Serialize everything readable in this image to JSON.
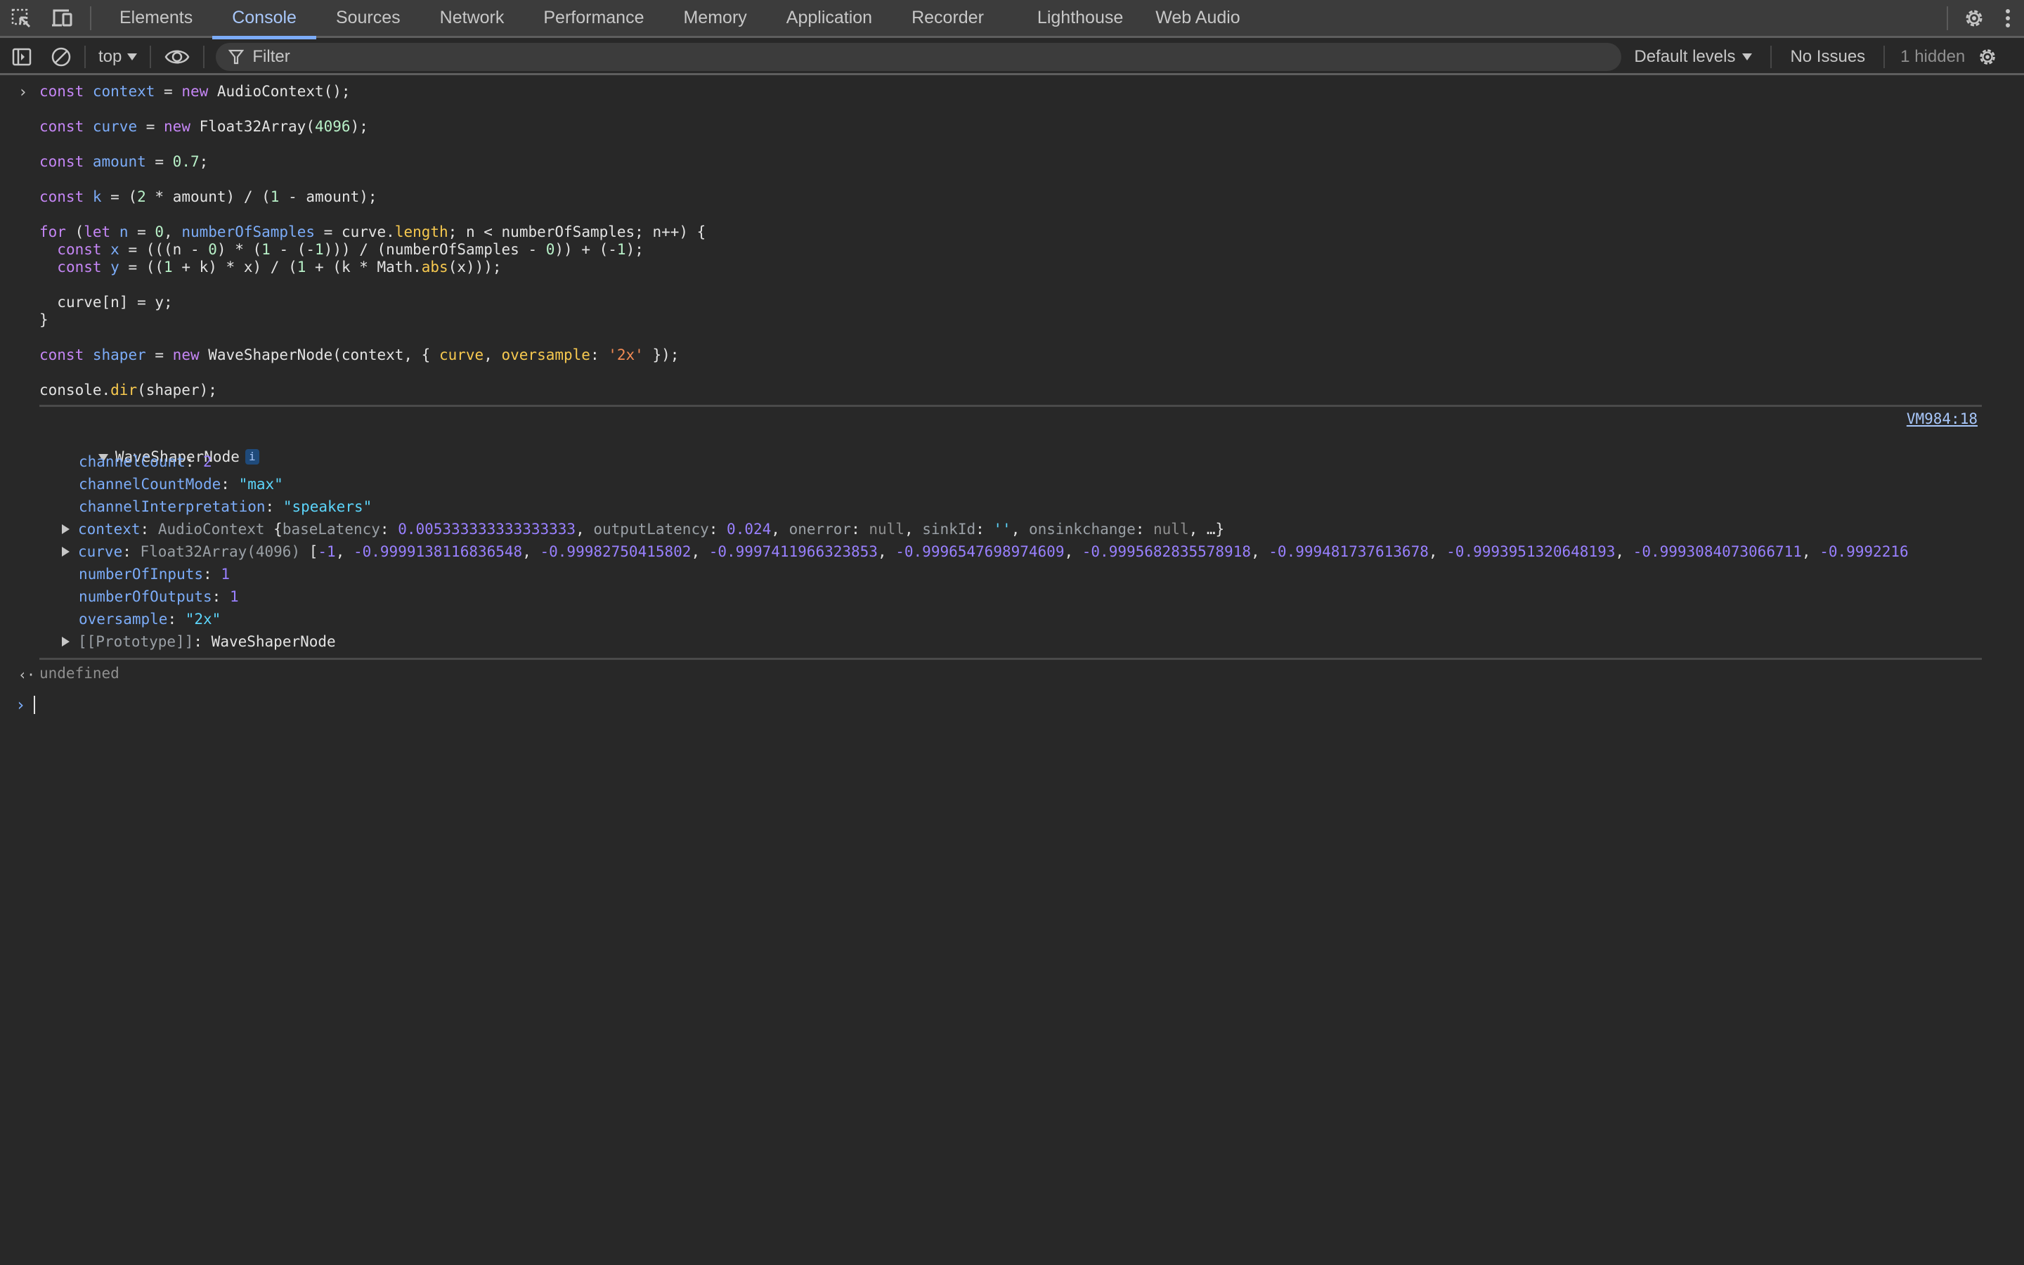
{
  "tabbar": {
    "tabs": [
      {
        "label": "Elements",
        "active": false
      },
      {
        "label": "Console",
        "active": true
      },
      {
        "label": "Sources",
        "active": false
      },
      {
        "label": "Network",
        "active": false
      },
      {
        "label": "Performance",
        "active": false
      },
      {
        "label": "Memory",
        "active": false
      },
      {
        "label": "Application",
        "active": false
      },
      {
        "label": "Recorder",
        "active": false
      },
      {
        "label": "Lighthouse",
        "active": false
      },
      {
        "label": "Web Audio",
        "active": false
      }
    ],
    "icons": [
      "inspect-element-icon",
      "device-toolbar-icon",
      "settings-icon",
      "more-options-icon"
    ]
  },
  "toolbar": {
    "context": "top",
    "filter_placeholder": "Filter",
    "levels": "Default levels",
    "issues": "No Issues",
    "hidden": "1 hidden"
  },
  "console": {
    "input_code": {
      "l1": {
        "kw1": "const",
        "v": "context",
        "eq": " = ",
        "kw2": "new",
        "rest": " AudioContext();"
      },
      "l2": {
        "kw1": "const",
        "v": "curve",
        "eq": " = ",
        "kw2": "new",
        "rest1": " Float32Array(",
        "num": "4096",
        "rest2": ");"
      },
      "l3": {
        "kw1": "const",
        "v": "amount",
        "eq": " = ",
        "num": "0.7",
        "rest": ";"
      },
      "l4": {
        "kw1": "const",
        "v": "k",
        "eq": " = (",
        "n1": "2",
        "m1": " * amount) / (",
        "n2": "1",
        "m2": " - amount);"
      },
      "l5": {
        "kw1": "for",
        "p1": " (",
        "kw2": "let",
        "v1": " n",
        "p2": " = ",
        "n1": "0",
        "p3": ", ",
        "v2": "numberOfSamples",
        "p4": " = curve.",
        "fn": "length",
        "p5": "; n < numberOfSamples; n++) {"
      },
      "l6": {
        "kw": "const",
        "v": "x",
        "a": " = (((n - ",
        "n0": "0",
        "b": ") * (",
        "n1": "1",
        "c": " - (-",
        "n2": "1",
        "d": "))) / (numberOfSamples - ",
        "n3": "0",
        "e": ")) + (-",
        "n4": "1",
        "f": ");"
      },
      "l7": {
        "kw": "const",
        "v": "y",
        "a": " = ((",
        "n1": "1",
        "b": " + k) * x) / (",
        "n2": "1",
        "c": " + (k * Math.",
        "fn": "abs",
        "d": "(x)));"
      },
      "l8": "curve[n] = y;",
      "l9": "}",
      "l10": {
        "kw1": "const",
        "v": "shaper",
        "eq": " = ",
        "kw2": "new",
        "a": " WaveShaperNode(context, { ",
        "p1": "curve",
        "b": ", ",
        "p2": "oversample",
        "c": ": ",
        "s": "'2x'",
        "d": " });"
      },
      "l11": {
        "a": "console.",
        "fn": "dir",
        "b": "(shaper);"
      }
    },
    "source_link": "VM984:18",
    "object": {
      "name": "WaveShaperNode",
      "info_badge": "i",
      "properties": {
        "channelCount": {
          "key": "channelCount",
          "value": "2"
        },
        "channelCountMode": {
          "key": "channelCountMode",
          "value": "\"max\""
        },
        "channelInterpretation": {
          "key": "channelInterpretation",
          "value": "\"speakers\""
        },
        "context": {
          "key": "context",
          "type": "AudioContext",
          "brace_open": " {",
          "baseLatency_key": "baseLatency",
          "baseLatency": "0.005333333333333333",
          "outputLatency_key": "outputLatency",
          "outputLatency": "0.024",
          "onerror_key": "onerror",
          "onerror": "null",
          "sinkId_key": "sinkId",
          "sinkId": "''",
          "onsinkchange_key": "onsinkchange",
          "onsinkchange": "null",
          "ellipsis": "…}"
        },
        "curve": {
          "key": "curve",
          "type": "Float32Array(4096)",
          "values": [
            "-1",
            "-0.9999138116836548",
            "-0.99982750415802",
            "-0.9997411966323853",
            "-0.9996547698974609",
            "-0.9995682835578918",
            "-0.999481737613678",
            "-0.9993951320648193",
            "-0.9993084073066711",
            "-0.9992216"
          ]
        },
        "numberOfInputs": {
          "key": "numberOfInputs",
          "value": "1"
        },
        "numberOfOutputs": {
          "key": "numberOfOutputs",
          "value": "1"
        },
        "oversample": {
          "key": "oversample",
          "value": "\"2x\""
        },
        "prototype": {
          "key": "[[Prototype]]",
          "value": "WaveShaperNode"
        }
      }
    },
    "return_value": "undefined",
    "prompt_value": ""
  }
}
